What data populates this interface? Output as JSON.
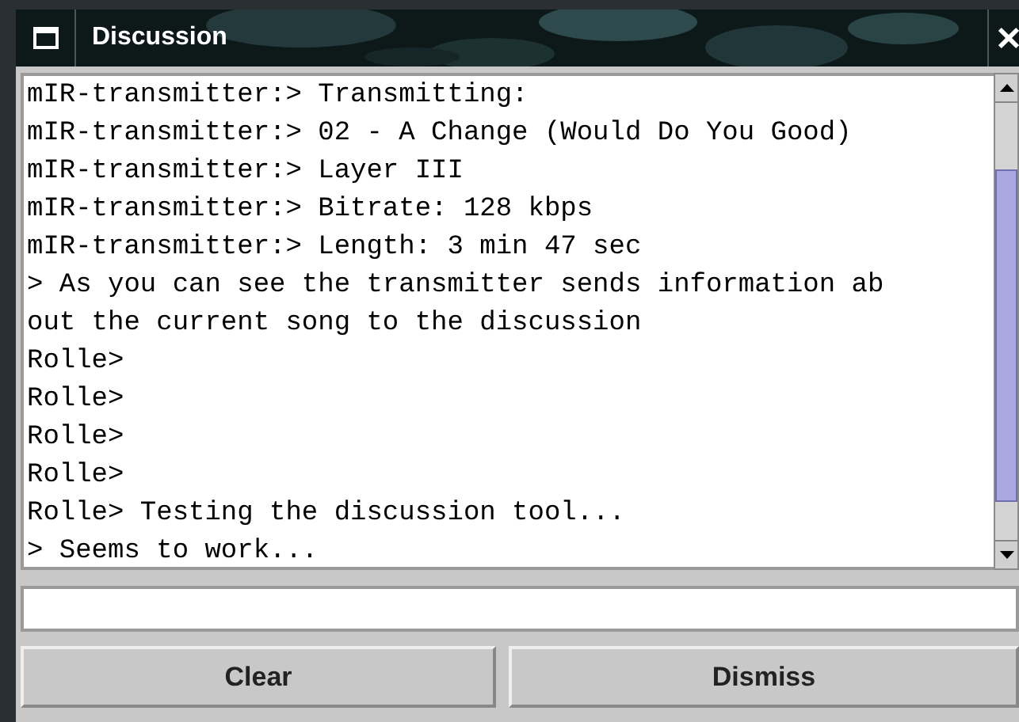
{
  "window": {
    "title": "Discussion"
  },
  "log": [
    "mIR-transmitter:> Transmitting:",
    "mIR-transmitter:> 02 - A Change (Would Do You Good)",
    "mIR-transmitter:> Layer III",
    "mIR-transmitter:> Bitrate: 128 kbps",
    "mIR-transmitter:> Length: 3 min 47 sec",
    "> As you can see the transmitter sends information ab",
    "out the current song to the discussion",
    "Rolle>",
    "Rolle>",
    "Rolle>",
    "Rolle>",
    "Rolle> Testing the discussion tool...",
    "> Seems to work..."
  ],
  "buttons": [
    "Clear",
    "Dismiss"
  ]
}
